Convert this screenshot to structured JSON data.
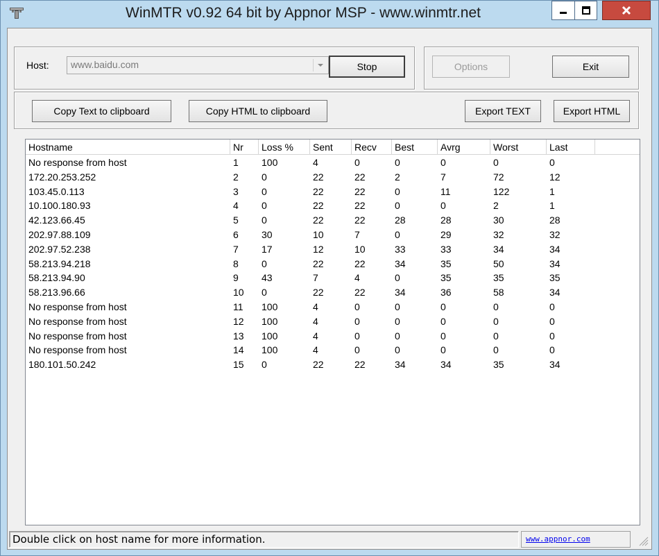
{
  "window": {
    "title": "WinMTR v0.92 64 bit by Appnor MSP - www.winmtr.net",
    "icon": "winmtr-app-icon"
  },
  "host": {
    "label": "Host:",
    "value": "www.baidu.com"
  },
  "buttons": {
    "stop": "Stop",
    "options": "Options",
    "exit": "Exit",
    "copy_text": "Copy Text to clipboard",
    "copy_html": "Copy HTML to clipboard",
    "export_text": "Export TEXT",
    "export_html": "Export HTML"
  },
  "table": {
    "headers": [
      "Hostname",
      "Nr",
      "Loss %",
      "Sent",
      "Recv",
      "Best",
      "Avrg",
      "Worst",
      "Last"
    ],
    "rows": [
      [
        "No response from host",
        "1",
        "100",
        "4",
        "0",
        "0",
        "0",
        "0",
        "0"
      ],
      [
        "172.20.253.252",
        "2",
        "0",
        "22",
        "22",
        "2",
        "7",
        "72",
        "12"
      ],
      [
        "103.45.0.113",
        "3",
        "0",
        "22",
        "22",
        "0",
        "11",
        "122",
        "1"
      ],
      [
        "10.100.180.93",
        "4",
        "0",
        "22",
        "22",
        "0",
        "0",
        "2",
        "1"
      ],
      [
        "42.123.66.45",
        "5",
        "0",
        "22",
        "22",
        "28",
        "28",
        "30",
        "28"
      ],
      [
        "202.97.88.109",
        "6",
        "30",
        "10",
        "7",
        "0",
        "29",
        "32",
        "32"
      ],
      [
        "202.97.52.238",
        "7",
        "17",
        "12",
        "10",
        "33",
        "33",
        "34",
        "34"
      ],
      [
        "58.213.94.218",
        "8",
        "0",
        "22",
        "22",
        "34",
        "35",
        "50",
        "34"
      ],
      [
        "58.213.94.90",
        "9",
        "43",
        "7",
        "4",
        "0",
        "35",
        "35",
        "35"
      ],
      [
        "58.213.96.66",
        "10",
        "0",
        "22",
        "22",
        "34",
        "36",
        "58",
        "34"
      ],
      [
        "No response from host",
        "11",
        "100",
        "4",
        "0",
        "0",
        "0",
        "0",
        "0"
      ],
      [
        "No response from host",
        "12",
        "100",
        "4",
        "0",
        "0",
        "0",
        "0",
        "0"
      ],
      [
        "No response from host",
        "13",
        "100",
        "4",
        "0",
        "0",
        "0",
        "0",
        "0"
      ],
      [
        "No response from host",
        "14",
        "100",
        "4",
        "0",
        "0",
        "0",
        "0",
        "0"
      ],
      [
        "180.101.50.242",
        "15",
        "0",
        "22",
        "22",
        "34",
        "34",
        "35",
        "34"
      ]
    ]
  },
  "status": {
    "message": "Double click on host name for more information.",
    "link": "www.appnor.com"
  },
  "colors": {
    "titlebar": "#bcdaef",
    "close_button": "#c74a3f",
    "link": "#0000ee"
  }
}
